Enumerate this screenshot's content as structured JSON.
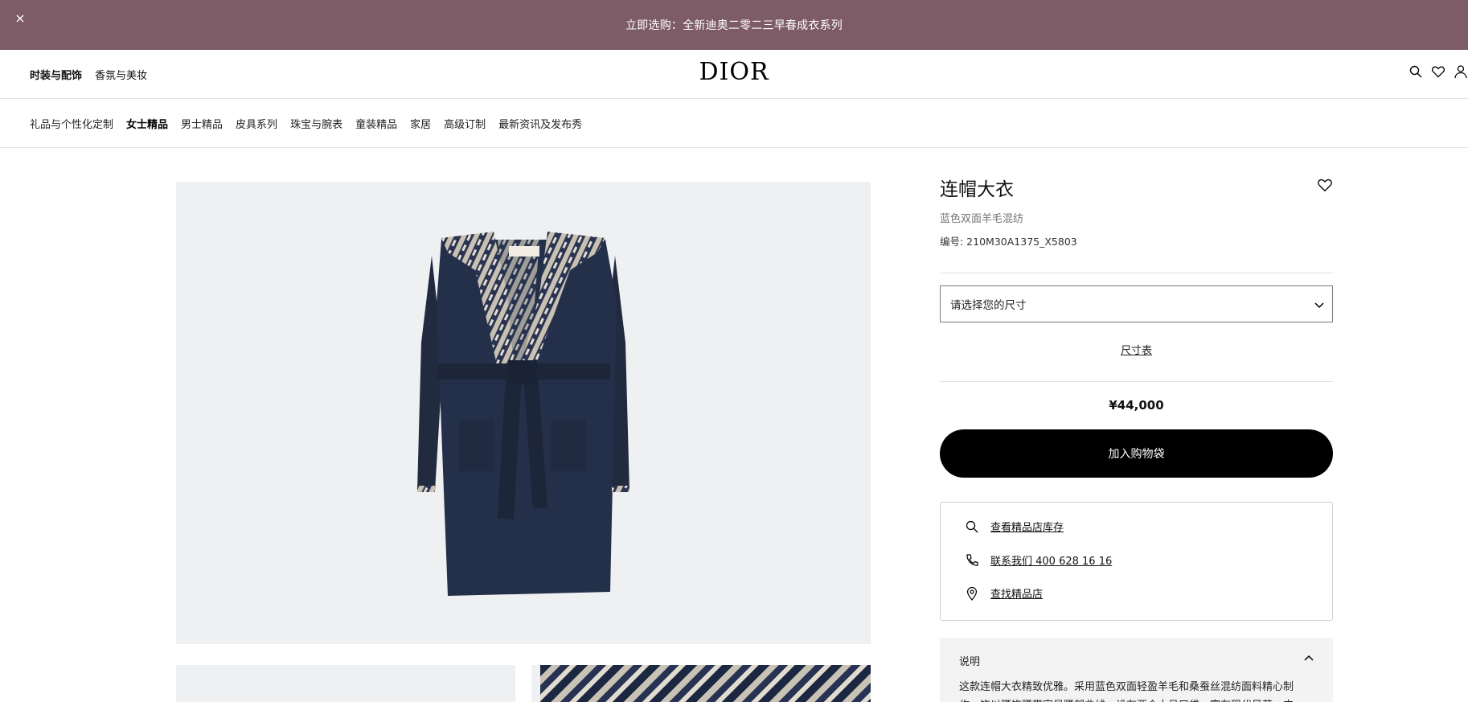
{
  "promo": {
    "text": "立即选购：全新迪奥二零二三早春成衣系列"
  },
  "header": {
    "left_links": [
      "时装与配饰",
      "香氛与美妆"
    ],
    "logo": "DIOR"
  },
  "category_nav": {
    "items": [
      "礼品与个性化定制",
      "女士精品",
      "男士精品",
      "皮具系列",
      "珠宝与腕表",
      "童装精品",
      "家居",
      "高级订制",
      "最新资讯及发布秀"
    ],
    "active": "女士精品"
  },
  "product": {
    "title": "连帽大衣",
    "subtitle": "蓝色双面羊毛混纺",
    "ref_label": "编号: 210M30A1375_X5803",
    "size_placeholder": "请选择您的尺寸",
    "size_guide": "尺寸表",
    "price": "¥44,000",
    "add_to_bag": "加入购物袋"
  },
  "services": {
    "stock": "查看精品店库存",
    "contact": "联系我们 400 628 16 16",
    "stores": "查找精品店"
  },
  "description": {
    "header": "说明",
    "text": "这款连帽大衣精致优雅。采用蓝色双面轻盈羊毛和桑蚕丝混纺面料精心制作，饰以腰饰腰带突显腰部曲线，设有两个大号口袋，富有现代风范。内衬"
  },
  "colors": {
    "promo_bg": "#7e5c67",
    "button_bg": "#000000",
    "image_bg": "#eff0f2",
    "coat": "#232b40"
  },
  "icons": {
    "promo_close": "close-icon",
    "header": [
      "search-icon",
      "heart-icon",
      "user-icon"
    ],
    "wishlist": "heart-icon",
    "size_select": "chevron-down-icon",
    "stock": "search-icon",
    "contact": "phone-icon",
    "stores": "location-pin-icon",
    "description": "chevron-up-icon"
  }
}
